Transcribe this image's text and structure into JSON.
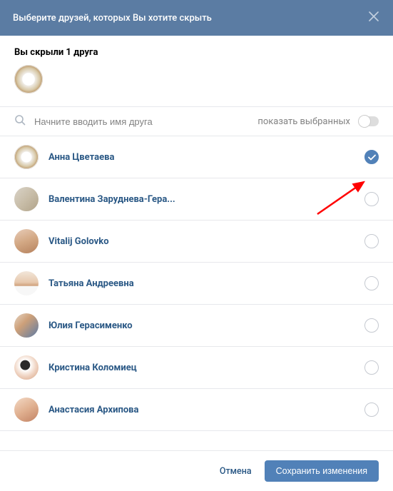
{
  "header": {
    "title": "Выберите друзей, которых Вы хотите скрыть"
  },
  "hidden": {
    "title": "Вы скрыли 1 друга"
  },
  "search": {
    "placeholder": "Начните вводить имя друга",
    "show_selected_label": "показать выбранных"
  },
  "friends": [
    {
      "name": "Анна Цветаева",
      "selected": true,
      "avatar": "av1"
    },
    {
      "name": "Валентина Заруднева-Гера...",
      "selected": false,
      "avatar": "av2"
    },
    {
      "name": "Vitalij Golovko",
      "selected": false,
      "avatar": "av3"
    },
    {
      "name": "Татьяна Андреевна",
      "selected": false,
      "avatar": "av4"
    },
    {
      "name": "Юлия Герасименко",
      "selected": false,
      "avatar": "av5"
    },
    {
      "name": "Кристина Коломиец",
      "selected": false,
      "avatar": "av6"
    },
    {
      "name": "Анастасия Архипова",
      "selected": false,
      "avatar": "av7"
    }
  ],
  "footer": {
    "cancel": "Отмена",
    "save": "Сохранить изменения"
  },
  "colors": {
    "header_bg": "#5b7ca3",
    "link": "#2a5885",
    "primary_btn": "#5181b8"
  }
}
